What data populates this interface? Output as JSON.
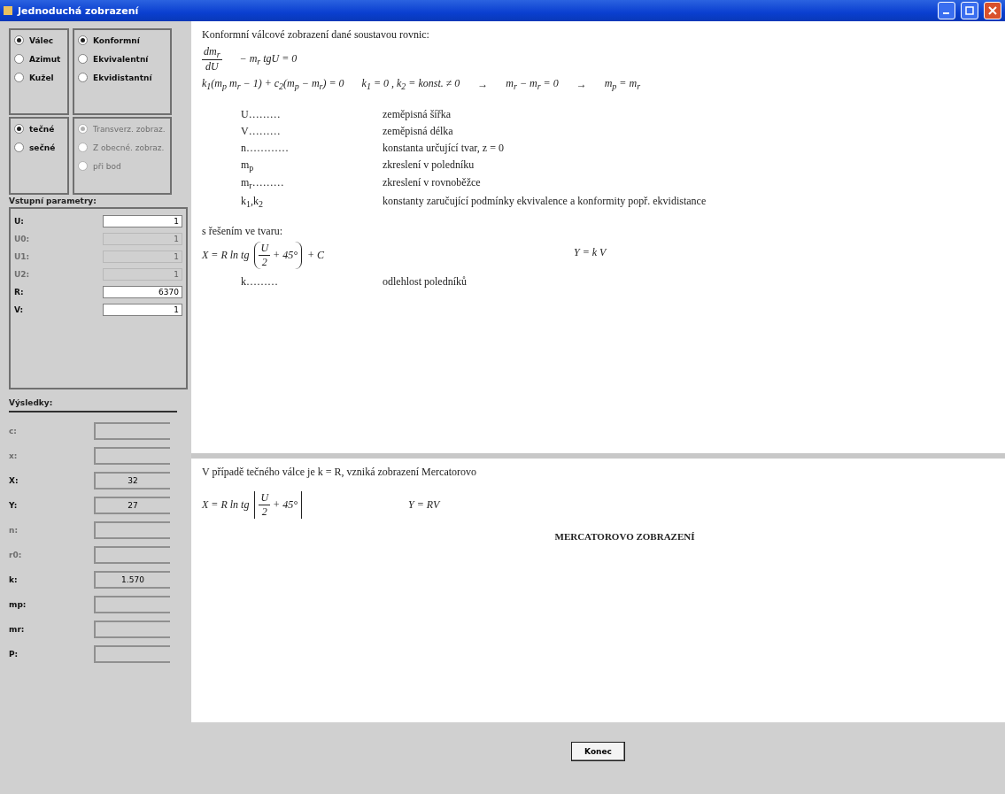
{
  "window": {
    "title": "Jednoduchá zobrazení"
  },
  "option_groups": [
    {
      "disabled": false,
      "options": [
        {
          "label": "Válec",
          "selected": true
        },
        {
          "label": "Azimut",
          "selected": false
        },
        {
          "label": "Kužel",
          "selected": false
        }
      ]
    },
    {
      "disabled": false,
      "options": [
        {
          "label": "Konformní",
          "selected": true
        },
        {
          "label": "Ekvivalentní",
          "selected": false
        },
        {
          "label": "Ekvidistantní",
          "selected": false
        }
      ]
    },
    {
      "disabled": false,
      "options": [
        {
          "label": "tečné",
          "selected": true
        },
        {
          "label": "sečné",
          "selected": false
        }
      ]
    },
    {
      "disabled": true,
      "options": [
        {
          "label": "Transverz. zobraz.",
          "selected": true
        },
        {
          "label": "Z obecné. zobraz.",
          "selected": false
        },
        {
          "label": "při bod",
          "selected": false
        }
      ]
    }
  ],
  "input_parameters": {
    "title": "Vstupní parametry:",
    "fields": [
      {
        "label": "U:",
        "value": "1",
        "disabled": false
      },
      {
        "label": "U0:",
        "value": "1",
        "disabled": true
      },
      {
        "label": "U1:",
        "value": "1",
        "disabled": true
      },
      {
        "label": "U2:",
        "value": "1",
        "disabled": true
      },
      {
        "label": "R:",
        "value": "6370",
        "disabled": false
      },
      {
        "label": "V:",
        "value": "1",
        "disabled": false
      }
    ]
  },
  "results": {
    "title": "Výsledky:",
    "fields": [
      {
        "label": "c:",
        "disabled": true
      },
      {
        "label": "x:",
        "disabled": true
      },
      {
        "label": "X:",
        "value": "32",
        "disabled": false
      },
      {
        "label": "Y:",
        "value": "27",
        "disabled": false
      },
      {
        "label": "n:",
        "disabled": true
      },
      {
        "label": "r0:",
        "disabled": true
      },
      {
        "label": "k:",
        "value": "1.570",
        "disabled": false
      },
      {
        "label": "mp:",
        "disabled": false
      },
      {
        "label": "mr:",
        "disabled": false
      },
      {
        "label": "P:",
        "disabled": false
      }
    ]
  },
  "description": {
    "heading": "Konformní válcové zobrazení dané soustavou rovnic:",
    "equations": [
      [
        {
          "kind": "fraction",
          "num": "dm$_{r}$",
          "den": "dU"
        },
        {
          "kind": "text",
          "text": "− m$_{r}$ tgU = 0"
        }
      ],
      [
        {
          "kind": "text",
          "text": "k$_{1}$(m$_{p}$ m$_{r}$ − 1) + c$_{2}$(m$_{p}$ − m$_{r}$) = 0"
        },
        {
          "kind": "text",
          "text": "k$_{1}$ = 0 ,  k$_{2}$ = konst. ≠ 0"
        },
        {
          "kind": "text",
          "text": "→"
        },
        {
          "kind": "text",
          "text": "m$_{r}$ − m$_{r}$ = 0"
        },
        {
          "kind": "text",
          "text": "→"
        },
        {
          "kind": "text",
          "text": "m$_{p}$ = m$_{r}$"
        }
      ]
    ],
    "legend": [
      {
        "symbol": "U",
        "dots": "………",
        "meaning": "zeměpisná šířka"
      },
      {
        "symbol": "V",
        "dots": "………",
        "meaning": "zeměpisná délka"
      },
      {
        "symbol": "n",
        "dots": "…………",
        "meaning": "konstanta určující tvar, z = 0"
      },
      {
        "symbol": "m$_{p}$",
        "meaning": "zkreslení v poledníku"
      },
      {
        "symbol": "m$_{r}$",
        "dots": "………",
        "meaning": "zkreslení v rovnoběžce"
      },
      {
        "symbol": "k$_{1}$,k$_{2}$",
        "meaning": "konstanty zaručující podmínky ekvivalence a konformity popř. ekvidistance"
      }
    ],
    "solution_label": "s řešením ve tvaru:",
    "solution": [
      [
        {
          "kind": "text",
          "text": "X = R ln tg"
        },
        {
          "kind": "paren_fraction",
          "num": "U",
          "den": "2",
          "after": "+ 45°"
        },
        {
          "kind": "text",
          "text": "+ C"
        }
      ],
      [
        {
          "kind": "text",
          "text": "Y = k V"
        }
      ]
    ],
    "note": {
      "symbol": "k",
      "dots": "………",
      "meaning": "odlehlost poledníků"
    }
  },
  "special_case": {
    "text": "V případě tečného válce je k = R, vzniká zobrazení Mercatorovo",
    "formula": [
      [
        {
          "kind": "text",
          "text": "X = R ln tg"
        },
        {
          "kind": "bracket_fraction",
          "num": "U",
          "den": "2",
          "after": "+ 45°"
        }
      ],
      [
        {
          "kind": "text",
          "text": "Y = RV"
        }
      ]
    ],
    "name": "MERCATOROVO ZOBRAZENÍ"
  },
  "buttons": [
    "Konec"
  ]
}
